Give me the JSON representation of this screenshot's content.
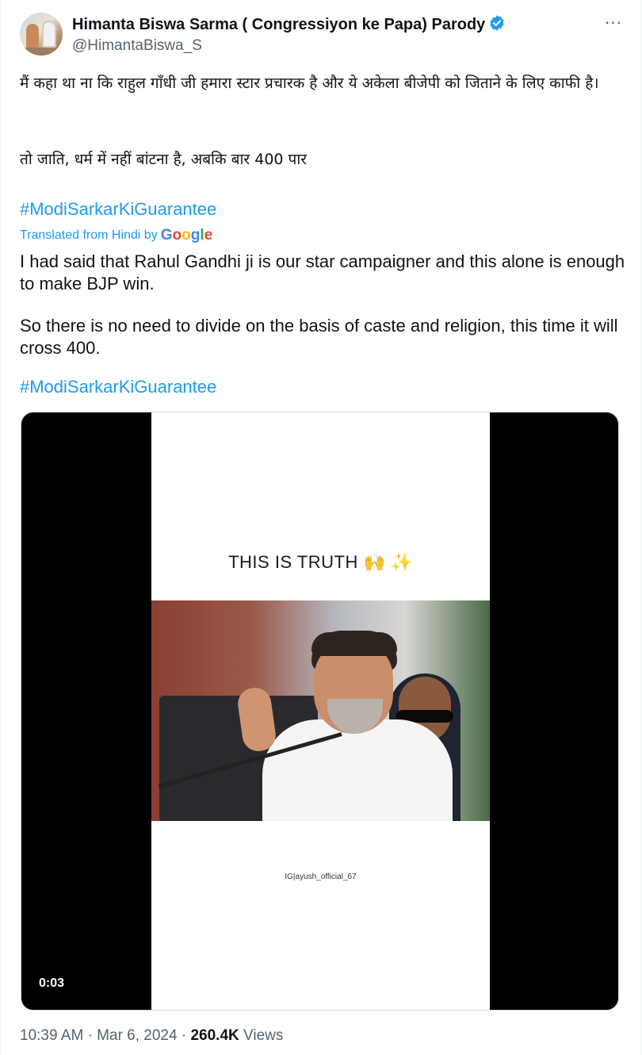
{
  "author": {
    "display_name": "Himanta Biswa Sarma ( Congressiyon ke Papa) Parody",
    "handle": "@HimantaBiswa_S",
    "verified": true
  },
  "tweet": {
    "hindi_line1": "मैं कहा था ना कि राहुल गाँधी जी हमारा स्टार प्रचारक है और ये अकेला बीजेपी को जिताने के लिए काफी है।",
    "hindi_line2": "तो जाति, धर्म में नहीं बांटना है, अबकि बार 400 पार",
    "hashtag": "#ModiSarkarKiGuarantee",
    "translated_label": "Translated from Hindi by",
    "translator": "Google",
    "english_line1": "I had said that Rahul Gandhi ji is our star campaigner and this alone is enough to make BJP win.",
    "english_line2": "So there is no need to divide on the basis of caste and religion, this time it will cross 400.",
    "english_hashtag": "#ModiSarkarKiGuarantee"
  },
  "media": {
    "caption": "THIS IS TRUTH 🙌 ✨",
    "watermark": "IG|ayush_official_67",
    "timer": "0:03"
  },
  "meta": {
    "time": "10:39 AM",
    "separator": "·",
    "date": "Mar 6, 2024",
    "views_count": "260.4K",
    "views_label": "Views"
  },
  "colors": {
    "link_blue": "#1d9bf0",
    "secondary_text": "#536471",
    "primary_text": "#0f1419"
  },
  "icons": {
    "verified": "verified-badge-icon",
    "more": "more-options-icon"
  }
}
